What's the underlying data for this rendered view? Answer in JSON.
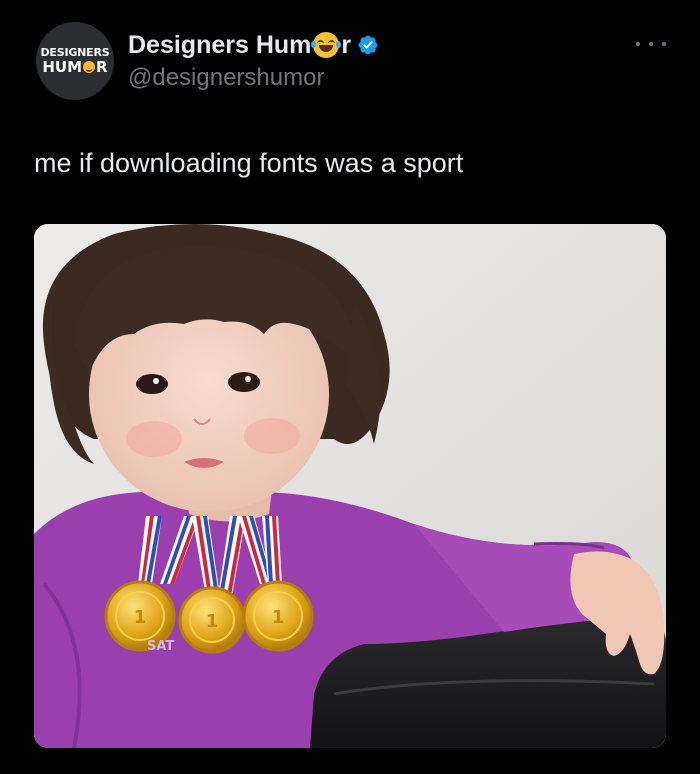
{
  "author": {
    "avatar_text_top": "DESIGNERS",
    "avatar_text_bottom_left": "HUM",
    "avatar_text_bottom_right": "R",
    "avatar_icon": "laughing-face-icon",
    "display_name_before_emoji": "Designers Hum",
    "display_name_after_emoji": "r",
    "display_name_emoji": "face-with-tears-of-joy-icon",
    "handle": "@designershumor",
    "verified_icon": "verified-badge-icon"
  },
  "tweet": {
    "text": "me if downloading fonts was a sport"
  },
  "media": {
    "description_icon": "photo",
    "shirt_text": "SAT"
  },
  "menu": {
    "icon": "more-horizontal-icon"
  },
  "colors": {
    "background": "#000000",
    "primary_text": "#e7e9ea",
    "secondary_text": "#71767b",
    "verified": "#1d9bf0",
    "avatar_bg": "#2b2d31"
  }
}
